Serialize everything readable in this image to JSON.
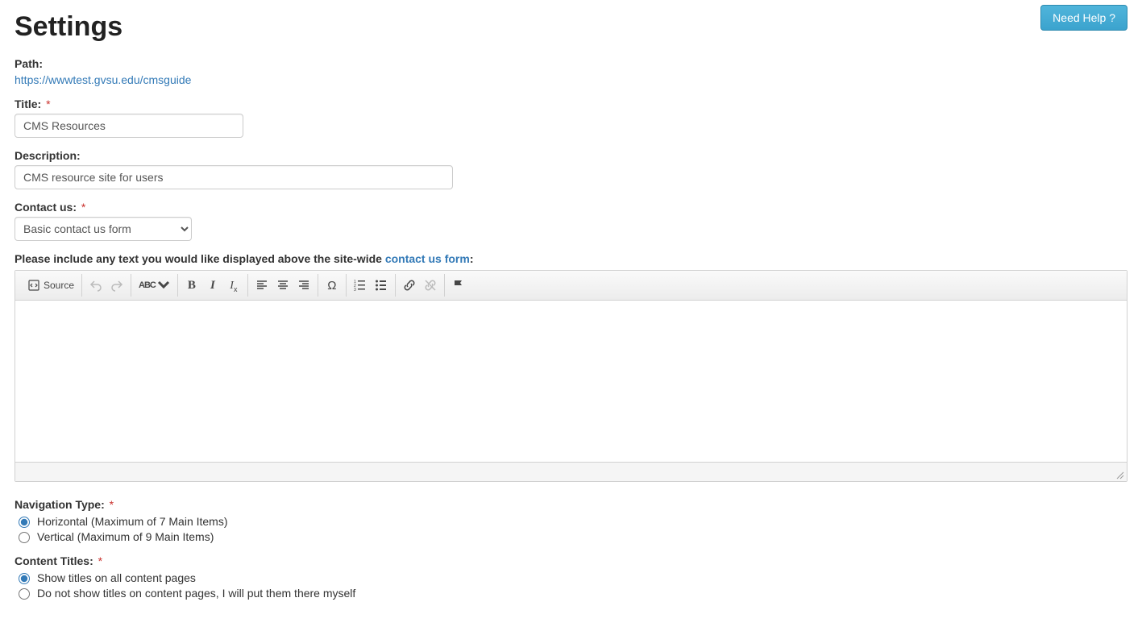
{
  "header": {
    "title": "Settings",
    "help_button": "Need Help ?"
  },
  "path": {
    "label": "Path:",
    "url": "https://wwwtest.gvsu.edu/cmsguide"
  },
  "title_field": {
    "label": "Title:",
    "value": "CMS Resources"
  },
  "description_field": {
    "label": "Description:",
    "value": "CMS resource site for users"
  },
  "contact_us": {
    "label": "Contact us:",
    "options": [
      "Basic contact us form"
    ],
    "selected": "Basic contact us form"
  },
  "editor_intro": {
    "prefix": "Please include any text you would like displayed above the site-wide ",
    "link_text": "contact us form",
    "suffix": ":"
  },
  "toolbar": {
    "source": "Source"
  },
  "nav_type": {
    "label": "Navigation Type:",
    "options": [
      "Horizontal (Maximum of 7 Main Items)",
      "Vertical (Maximum of 9 Main Items)"
    ],
    "selected": 0
  },
  "content_titles": {
    "label": "Content Titles:",
    "options": [
      "Show titles on all content pages",
      "Do not show titles on content pages, I will put them there myself"
    ],
    "selected": 0
  }
}
